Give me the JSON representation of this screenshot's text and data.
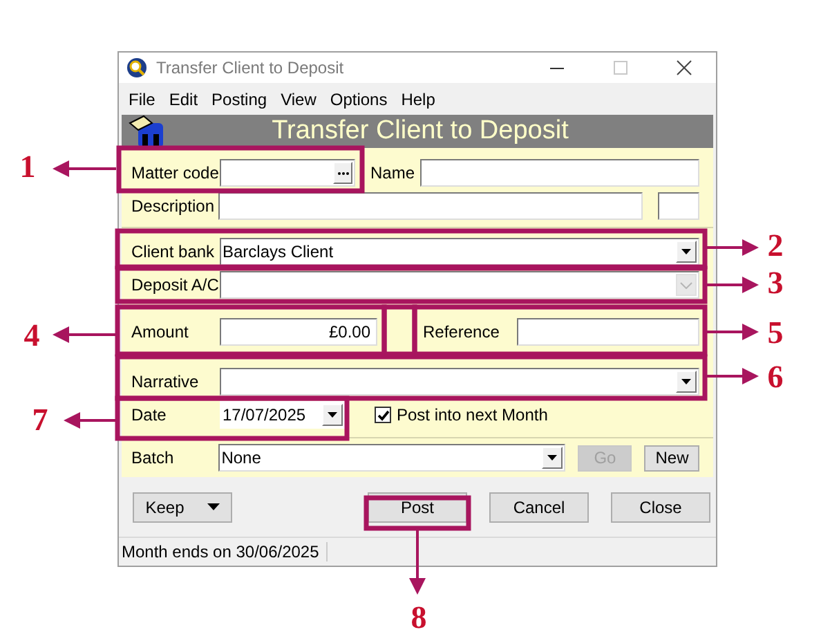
{
  "window": {
    "title": "Transfer Client to Deposit"
  },
  "menu": [
    "File",
    "Edit",
    "Posting",
    "View",
    "Options",
    "Help"
  ],
  "banner": {
    "title": "Transfer Client to Deposit"
  },
  "form": {
    "matter_code": {
      "label": "Matter code"
    },
    "name": {
      "label": "Name"
    },
    "description": {
      "label": "Description"
    },
    "client_bank": {
      "label": "Client bank",
      "value": "Barclays Client"
    },
    "deposit_ac": {
      "label": "Deposit A/C",
      "disabled": true
    },
    "amount": {
      "label": "Amount",
      "value": "£0.00"
    },
    "reference": {
      "label": "Reference"
    },
    "narrative": {
      "label": "Narrative"
    },
    "date": {
      "label": "Date",
      "value": "17/07/2025"
    },
    "post_next_month": {
      "label": "Post into next Month",
      "checked": true
    },
    "batch": {
      "label": "Batch",
      "value": "None"
    },
    "batch_buttons": [
      {
        "label": "Go",
        "disabled": true
      },
      {
        "label": "New",
        "disabled": false
      }
    ]
  },
  "buttons": [
    {
      "label": "Keep",
      "kind": "split"
    },
    {
      "label": "Post",
      "kind": "plain"
    },
    {
      "label": "Cancel",
      "kind": "plain"
    },
    {
      "label": "Close",
      "kind": "plain"
    }
  ],
  "status_bar": "Month ends on 30/06/2025",
  "callouts": [
    {
      "number": "1"
    },
    {
      "number": "2"
    },
    {
      "number": "3"
    },
    {
      "number": "4"
    },
    {
      "number": "5"
    },
    {
      "number": "6"
    },
    {
      "number": "7"
    },
    {
      "number": "8"
    }
  ]
}
